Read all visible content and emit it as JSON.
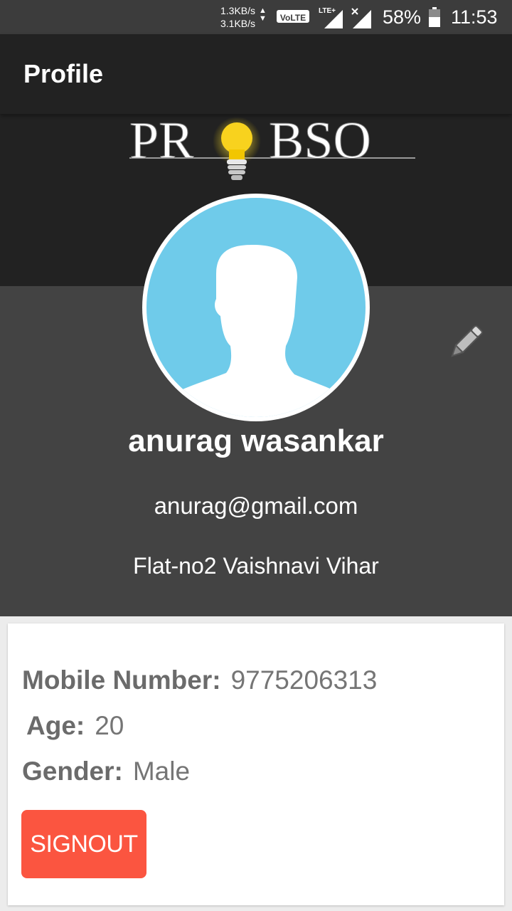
{
  "status_bar": {
    "net_up": "1.3KB/s",
    "net_down": "3.1KB/s",
    "volte": "VoLTE",
    "lte": "LTE+",
    "battery": "58%",
    "time": "11:53"
  },
  "appbar": {
    "title": "Profile"
  },
  "logo": {
    "text_left": "PR",
    "text_right": "BSO"
  },
  "profile": {
    "name": "anurag wasankar",
    "email": "anurag@gmail.com",
    "address": "Flat-no2 Vaishnavi Vihar"
  },
  "details": {
    "mobile_label": "Mobile Number:",
    "mobile_value": "9775206313",
    "age_label": "Age:",
    "age_value": "20",
    "gender_label": "Gender:",
    "gender_value": "Male"
  },
  "actions": {
    "signout_label": "SIGNOUT"
  },
  "colors": {
    "appbar": "#222222",
    "header": "#434343",
    "avatar_bg": "#6fcbea",
    "signout": "#fb5540"
  },
  "icons": {
    "edit": "pencil-icon",
    "avatar": "person-silhouette-icon",
    "logo_bulb": "lightbulb-icon"
  }
}
